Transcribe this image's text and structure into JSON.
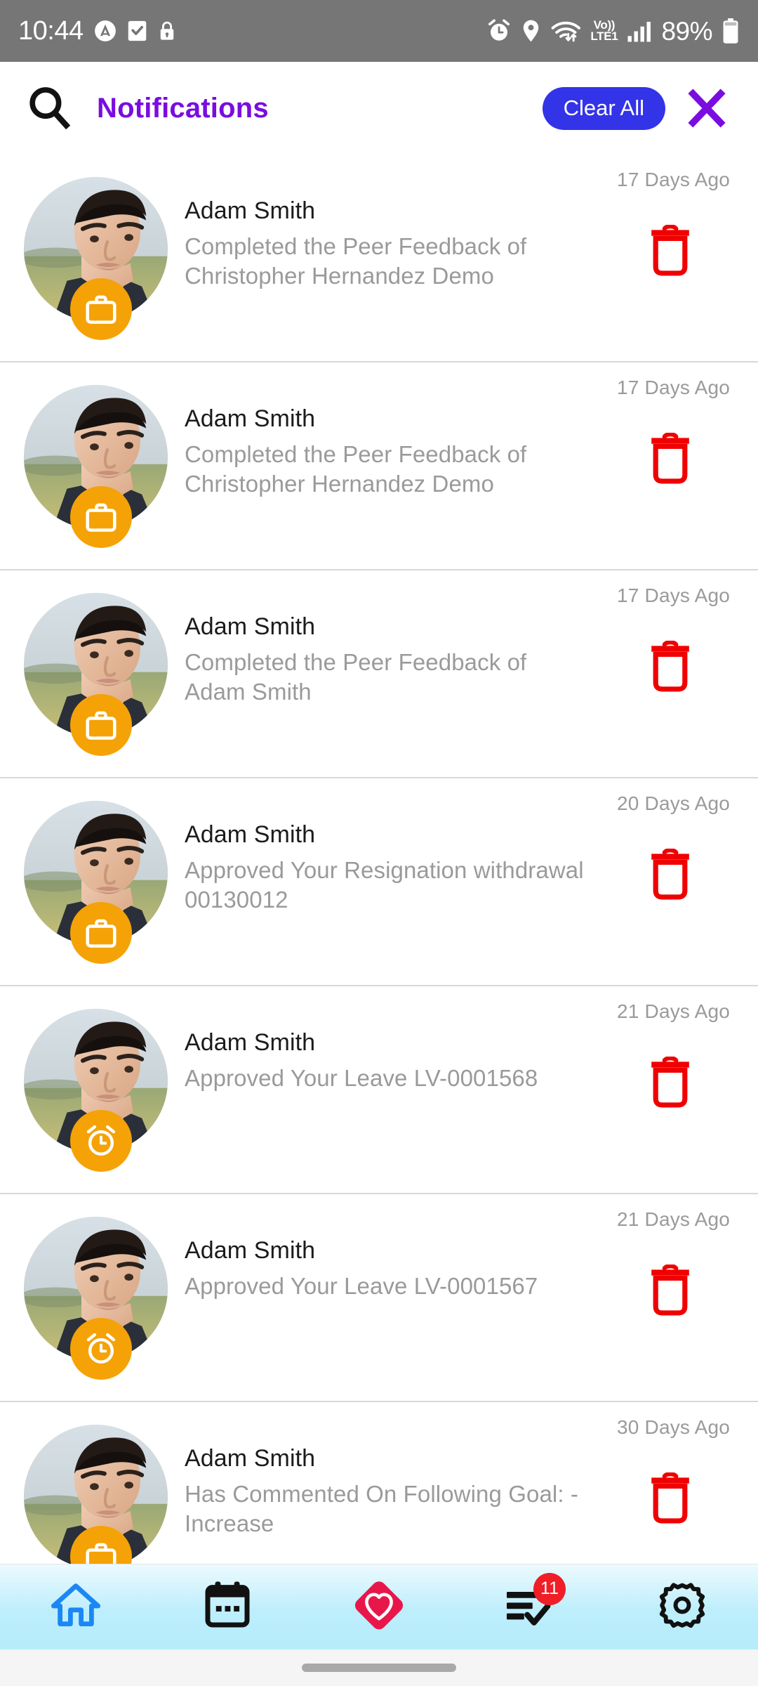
{
  "status_bar": {
    "time": "10:44",
    "battery_percent": "89%",
    "network_label_top": "Vo))",
    "network_label_bottom": "LTE1",
    "left_icons": [
      "antivirus-icon",
      "checkbox-icon",
      "lock-icon"
    ],
    "right_icons": [
      "alarm-icon",
      "location-icon",
      "wifi-icon",
      "signal-icon",
      "battery-icon"
    ]
  },
  "header": {
    "title": "Notifications",
    "clear_all_label": "Clear All",
    "title_color": "#7A0CE0",
    "clear_button_color": "#3333E8",
    "close_color": "#7A0CE0"
  },
  "notifications": [
    {
      "name": "Adam  Smith",
      "message": "Completed the Peer Feedback of Christopher Hernandez Demo",
      "time": "17 Days Ago",
      "badge": "briefcase-icon"
    },
    {
      "name": "Adam  Smith",
      "message": "Completed the Peer Feedback of Christopher Hernandez Demo",
      "time": "17 Days Ago",
      "badge": "briefcase-icon"
    },
    {
      "name": "Adam  Smith",
      "message": "Completed the Peer Feedback of Adam  Smith",
      "time": "17 Days Ago",
      "badge": "briefcase-icon"
    },
    {
      "name": "Adam  Smith",
      "message": "Approved Your Resignation withdrawal 00130012",
      "time": "20 Days Ago",
      "badge": "briefcase-icon"
    },
    {
      "name": "Adam  Smith",
      "message": "Approved Your Leave LV-0001568",
      "time": "21 Days Ago",
      "badge": "alarm-icon"
    },
    {
      "name": "Adam  Smith",
      "message": "Approved Your Leave LV-0001567",
      "time": "21 Days Ago",
      "badge": "alarm-icon"
    },
    {
      "name": "Adam  Smith",
      "message": "Has Commented On Following Goal: - Increase",
      "time": "30 Days Ago",
      "badge": "briefcase-icon"
    }
  ],
  "bottom_nav": {
    "items": [
      {
        "icon": "home-icon",
        "badge": ""
      },
      {
        "icon": "calendar-icon",
        "badge": ""
      },
      {
        "icon": "heart-diamond-icon",
        "badge": ""
      },
      {
        "icon": "task-list-check-icon",
        "badge": "11"
      },
      {
        "icon": "settings-gear-icon",
        "badge": ""
      }
    ],
    "badge_color": "#F01E27",
    "home_color": "#1B87F5",
    "heart_color": "#E8174A"
  },
  "colors": {
    "delete_icon": "#F00000",
    "badge_orange": "#F5A207",
    "secondary_text": "#9a9a9a"
  }
}
